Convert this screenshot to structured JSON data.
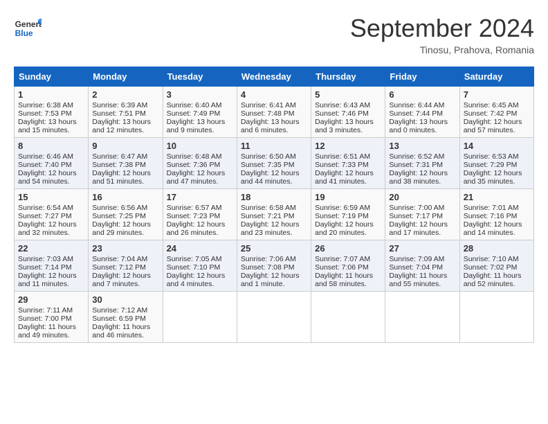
{
  "header": {
    "logo_general": "General",
    "logo_blue": "Blue",
    "title": "September 2024",
    "subtitle": "Tinosu, Prahova, Romania"
  },
  "weekdays": [
    "Sunday",
    "Monday",
    "Tuesday",
    "Wednesday",
    "Thursday",
    "Friday",
    "Saturday"
  ],
  "weeks": [
    [
      {
        "day": "1",
        "lines": [
          "Sunrise: 6:38 AM",
          "Sunset: 7:53 PM",
          "Daylight: 13 hours",
          "and 15 minutes."
        ]
      },
      {
        "day": "2",
        "lines": [
          "Sunrise: 6:39 AM",
          "Sunset: 7:51 PM",
          "Daylight: 13 hours",
          "and 12 minutes."
        ]
      },
      {
        "day": "3",
        "lines": [
          "Sunrise: 6:40 AM",
          "Sunset: 7:49 PM",
          "Daylight: 13 hours",
          "and 9 minutes."
        ]
      },
      {
        "day": "4",
        "lines": [
          "Sunrise: 6:41 AM",
          "Sunset: 7:48 PM",
          "Daylight: 13 hours",
          "and 6 minutes."
        ]
      },
      {
        "day": "5",
        "lines": [
          "Sunrise: 6:43 AM",
          "Sunset: 7:46 PM",
          "Daylight: 13 hours",
          "and 3 minutes."
        ]
      },
      {
        "day": "6",
        "lines": [
          "Sunrise: 6:44 AM",
          "Sunset: 7:44 PM",
          "Daylight: 13 hours",
          "and 0 minutes."
        ]
      },
      {
        "day": "7",
        "lines": [
          "Sunrise: 6:45 AM",
          "Sunset: 7:42 PM",
          "Daylight: 12 hours",
          "and 57 minutes."
        ]
      }
    ],
    [
      {
        "day": "8",
        "lines": [
          "Sunrise: 6:46 AM",
          "Sunset: 7:40 PM",
          "Daylight: 12 hours",
          "and 54 minutes."
        ]
      },
      {
        "day": "9",
        "lines": [
          "Sunrise: 6:47 AM",
          "Sunset: 7:38 PM",
          "Daylight: 12 hours",
          "and 51 minutes."
        ]
      },
      {
        "day": "10",
        "lines": [
          "Sunrise: 6:48 AM",
          "Sunset: 7:36 PM",
          "Daylight: 12 hours",
          "and 47 minutes."
        ]
      },
      {
        "day": "11",
        "lines": [
          "Sunrise: 6:50 AM",
          "Sunset: 7:35 PM",
          "Daylight: 12 hours",
          "and 44 minutes."
        ]
      },
      {
        "day": "12",
        "lines": [
          "Sunrise: 6:51 AM",
          "Sunset: 7:33 PM",
          "Daylight: 12 hours",
          "and 41 minutes."
        ]
      },
      {
        "day": "13",
        "lines": [
          "Sunrise: 6:52 AM",
          "Sunset: 7:31 PM",
          "Daylight: 12 hours",
          "and 38 minutes."
        ]
      },
      {
        "day": "14",
        "lines": [
          "Sunrise: 6:53 AM",
          "Sunset: 7:29 PM",
          "Daylight: 12 hours",
          "and 35 minutes."
        ]
      }
    ],
    [
      {
        "day": "15",
        "lines": [
          "Sunrise: 6:54 AM",
          "Sunset: 7:27 PM",
          "Daylight: 12 hours",
          "and 32 minutes."
        ]
      },
      {
        "day": "16",
        "lines": [
          "Sunrise: 6:56 AM",
          "Sunset: 7:25 PM",
          "Daylight: 12 hours",
          "and 29 minutes."
        ]
      },
      {
        "day": "17",
        "lines": [
          "Sunrise: 6:57 AM",
          "Sunset: 7:23 PM",
          "Daylight: 12 hours",
          "and 26 minutes."
        ]
      },
      {
        "day": "18",
        "lines": [
          "Sunrise: 6:58 AM",
          "Sunset: 7:21 PM",
          "Daylight: 12 hours",
          "and 23 minutes."
        ]
      },
      {
        "day": "19",
        "lines": [
          "Sunrise: 6:59 AM",
          "Sunset: 7:19 PM",
          "Daylight: 12 hours",
          "and 20 minutes."
        ]
      },
      {
        "day": "20",
        "lines": [
          "Sunrise: 7:00 AM",
          "Sunset: 7:17 PM",
          "Daylight: 12 hours",
          "and 17 minutes."
        ]
      },
      {
        "day": "21",
        "lines": [
          "Sunrise: 7:01 AM",
          "Sunset: 7:16 PM",
          "Daylight: 12 hours",
          "and 14 minutes."
        ]
      }
    ],
    [
      {
        "day": "22",
        "lines": [
          "Sunrise: 7:03 AM",
          "Sunset: 7:14 PM",
          "Daylight: 12 hours",
          "and 11 minutes."
        ]
      },
      {
        "day": "23",
        "lines": [
          "Sunrise: 7:04 AM",
          "Sunset: 7:12 PM",
          "Daylight: 12 hours",
          "and 7 minutes."
        ]
      },
      {
        "day": "24",
        "lines": [
          "Sunrise: 7:05 AM",
          "Sunset: 7:10 PM",
          "Daylight: 12 hours",
          "and 4 minutes."
        ]
      },
      {
        "day": "25",
        "lines": [
          "Sunrise: 7:06 AM",
          "Sunset: 7:08 PM",
          "Daylight: 12 hours",
          "and 1 minute."
        ]
      },
      {
        "day": "26",
        "lines": [
          "Sunrise: 7:07 AM",
          "Sunset: 7:06 PM",
          "Daylight: 11 hours",
          "and 58 minutes."
        ]
      },
      {
        "day": "27",
        "lines": [
          "Sunrise: 7:09 AM",
          "Sunset: 7:04 PM",
          "Daylight: 11 hours",
          "and 55 minutes."
        ]
      },
      {
        "day": "28",
        "lines": [
          "Sunrise: 7:10 AM",
          "Sunset: 7:02 PM",
          "Daylight: 11 hours",
          "and 52 minutes."
        ]
      }
    ],
    [
      {
        "day": "29",
        "lines": [
          "Sunrise: 7:11 AM",
          "Sunset: 7:00 PM",
          "Daylight: 11 hours",
          "and 49 minutes."
        ]
      },
      {
        "day": "30",
        "lines": [
          "Sunrise: 7:12 AM",
          "Sunset: 6:59 PM",
          "Daylight: 11 hours",
          "and 46 minutes."
        ]
      },
      null,
      null,
      null,
      null,
      null
    ]
  ]
}
